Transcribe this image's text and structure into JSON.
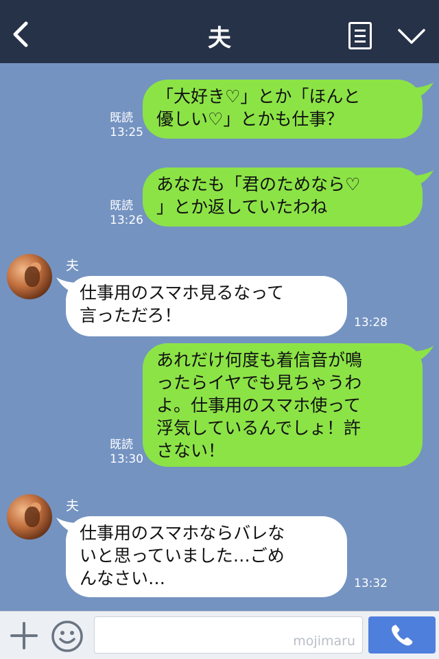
{
  "header": {
    "title": "夫",
    "back_icon": "chevron-left-icon",
    "menu_icon": "list-icon",
    "dropdown_icon": "chevron-down-icon"
  },
  "messages": [
    {
      "from": "me",
      "text": "「大好き♡」とか「ほんと\n優しい♡」とかも仕事？",
      "read": "既読",
      "time": "13:25"
    },
    {
      "from": "me",
      "text": "あなたも「君のためなら♡\n」とか返していたわね",
      "read": "既読",
      "time": "13:26"
    },
    {
      "from": "them",
      "sender": "夫",
      "text": "仕事用のスマホ見るなって\n言っただろ！",
      "time": "13:28"
    },
    {
      "from": "me",
      "text": "あれだけ何度も着信音が鳴\nったらイヤでも見ちゃうわ\nよ。仕事用のスマホ使って\n浮気しているんでしょ！許\nさない！",
      "read": "既読",
      "time": "13:30"
    },
    {
      "from": "them",
      "sender": "夫",
      "text": "仕事用のスマホならバレな\nいと思っていました…ごめ\nんなさい…",
      "time": "13:32"
    }
  ],
  "footer": {
    "input_value": "",
    "watermark": "mojimaru",
    "plus_icon": "plus-icon",
    "emoji_icon": "smiley-icon",
    "call_icon": "phone-icon"
  },
  "colors": {
    "header_bg": "#263248",
    "chat_bg": "#7493c1",
    "my_bubble": "#8ce346",
    "their_bubble": "#ffffff",
    "call_button": "#4f7fdc"
  }
}
